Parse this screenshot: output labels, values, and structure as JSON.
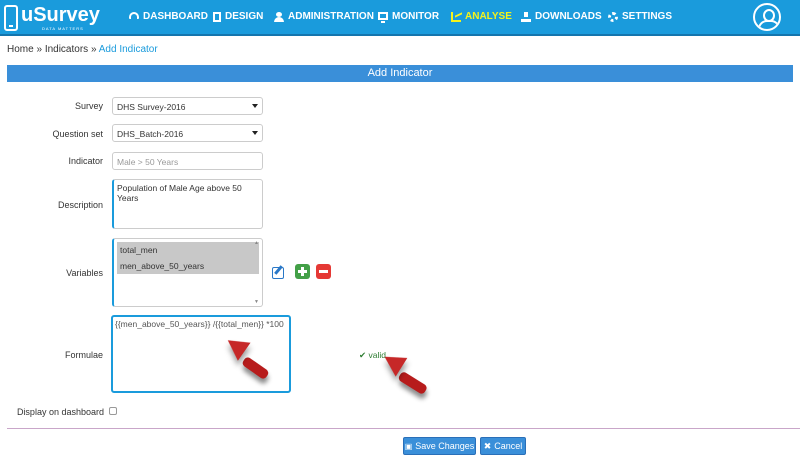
{
  "app": {
    "name": "uSurvey",
    "tagline": "DATA MATTERS"
  },
  "nav": [
    {
      "label": "DASHBOARD",
      "icon": "dashboard-icon"
    },
    {
      "label": "DESIGN",
      "icon": "document-icon"
    },
    {
      "label": "ADMINISTRATION",
      "icon": "user-icon"
    },
    {
      "label": "MONITOR",
      "icon": "monitor-icon"
    },
    {
      "label": "ANALYSE",
      "icon": "chart-icon",
      "active": true
    },
    {
      "label": "DOWNLOADS",
      "icon": "download-icon"
    },
    {
      "label": "SETTINGS",
      "icon": "gear-icon"
    }
  ],
  "breadcrumb": {
    "home": "Home",
    "sep1": " » ",
    "indicators": "Indicators",
    "sep2": " » ",
    "current": "Add Indicator"
  },
  "panel": {
    "title": "Add Indicator"
  },
  "form": {
    "survey": {
      "label": "Survey",
      "value": "DHS Survey-2016"
    },
    "question_set": {
      "label": "Question set",
      "value": "DHS_Batch-2016"
    },
    "indicator": {
      "label": "Indicator",
      "placeholder": "Male > 50 Years"
    },
    "description": {
      "label": "Description",
      "value": "Population of Male Age above 50 Years"
    },
    "variables": {
      "label": "Variables",
      "options": [
        "total_men",
        "men_above_50_years"
      ]
    },
    "formulae": {
      "label": "Formulae",
      "value": "{{men_above_50_years}} /{{total_men}} *100",
      "status": "valid"
    },
    "display_on_dashboard": {
      "label": "Display on dashboard",
      "checked": false
    }
  },
  "buttons": {
    "save": "Save Changes",
    "cancel": "Cancel"
  },
  "colors": {
    "header": "#1a9bdc",
    "panel": "#3a8fd9",
    "active_nav": "#f5f31b",
    "valid": "#2e7d32"
  }
}
